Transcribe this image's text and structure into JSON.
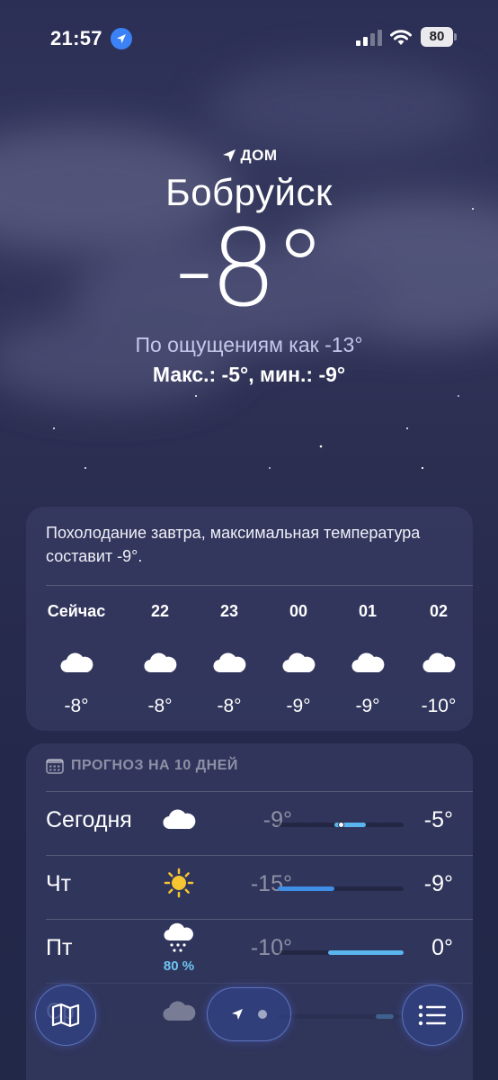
{
  "status_bar": {
    "time": "21:57",
    "battery": "80"
  },
  "location": {
    "label": "ДОМ",
    "city": "Бобруйск",
    "temperature": "-8°",
    "feels_like": "По ощущениям как -13°",
    "high_low": "Макс.: -5°, мин.: -9°"
  },
  "hourly": {
    "summary": "Похолодание завтра, максимальная температура составит -9°.",
    "items": [
      {
        "time": "Сейчас",
        "icon": "cloud-icon",
        "temp": "-8°"
      },
      {
        "time": "22",
        "icon": "cloud-icon",
        "temp": "-8°"
      },
      {
        "time": "23",
        "icon": "cloud-icon",
        "temp": "-8°"
      },
      {
        "time": "00",
        "icon": "cloud-icon",
        "temp": "-9°"
      },
      {
        "time": "01",
        "icon": "cloud-icon",
        "temp": "-9°"
      },
      {
        "time": "02",
        "icon": "cloud-icon",
        "temp": "-10°"
      }
    ]
  },
  "forecast": {
    "title": "ПРОГНОЗ НА 10 ДНЕЙ",
    "days": [
      {
        "day": "Сегодня",
        "icon": "cloud-icon",
        "low": "-9°",
        "high": "-5°",
        "range_start": 0.45,
        "range_end": 0.7,
        "current": 0.5
      },
      {
        "day": "Чт",
        "icon": "sun-icon",
        "low": "-15°",
        "high": "-9°",
        "range_start": 0.0,
        "range_end": 0.45
      },
      {
        "day": "Пт",
        "icon": "snow-cloud-icon",
        "precip": "80 %",
        "low": "-10°",
        "high": "0°",
        "range_start": 0.4,
        "range_end": 1.0
      },
      {
        "day": "Ср",
        "icon": "cloud-icon",
        "low": "",
        "high": "",
        "range_start": 0.78,
        "range_end": 0.92
      }
    ]
  },
  "colors": {
    "bar_cold": "#3f8fe6",
    "bar_mild": "#5ab4ee",
    "precip": "#6fc6f3"
  },
  "toolbar": {
    "map_icon": "map-icon",
    "list_icon": "list-icon",
    "location_icon": "location-arrow-icon"
  }
}
